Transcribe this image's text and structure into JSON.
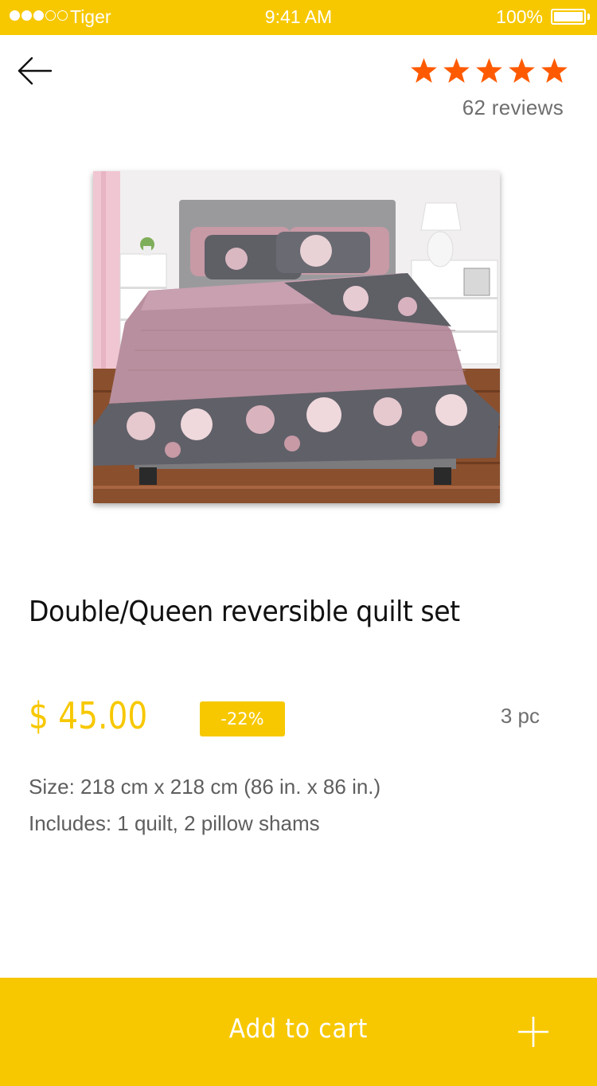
{
  "status_bar": {
    "carrier": "Tiger",
    "time": "9:41 AM",
    "battery": "100%",
    "signal_bars_filled": 3,
    "signal_bars_total": 5
  },
  "header": {
    "back_icon": "arrow-left-icon",
    "rating_stars": 5,
    "star_color": "#ff5a00",
    "reviews_label": "62 reviews"
  },
  "product": {
    "image_icon": "product-photo-bed-quilt",
    "title": "Double/Queen reversible quilt set",
    "price": "$ 45.00",
    "discount": "-22%",
    "pieces": "3 pc",
    "size": "Size: 218 cm x 218 cm (86 in. x 86 in.)",
    "includes": "Includes: 1 quilt, 2 pillow shams"
  },
  "cart": {
    "label": "Add to cart",
    "icon": "plus-icon"
  },
  "colors": {
    "accent": "#f7c800",
    "star": "#ff5a00",
    "muted_text": "#6e6e6e"
  }
}
